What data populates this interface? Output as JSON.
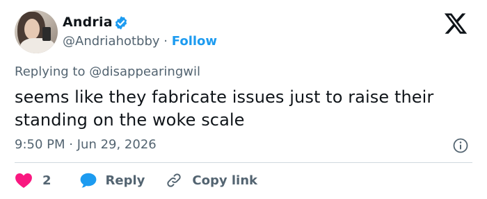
{
  "author": {
    "name": "Andria",
    "handle": "@Andriahotbby",
    "separator": "·",
    "follow_label": "Follow"
  },
  "reply": {
    "prefix": "Replying to",
    "mention": "@disappearingwil"
  },
  "tweet": {
    "text": "seems like they fabricate issues just to raise their standing on the woke scale",
    "time": "9:50 PM",
    "separator": "·",
    "date": "Jun 29, 2026"
  },
  "actions": {
    "like_count": "2",
    "reply_label": "Reply",
    "copy_label": "Copy link"
  },
  "colors": {
    "accent": "#1d9bf0",
    "like": "#f91880",
    "text": "#0f1419",
    "muted": "#536471",
    "divider": "#cfd9de"
  },
  "icons": [
    "verified-badge-icon",
    "x-logo-icon",
    "info-icon",
    "heart-icon",
    "speech-bubble-icon",
    "link-icon"
  ]
}
